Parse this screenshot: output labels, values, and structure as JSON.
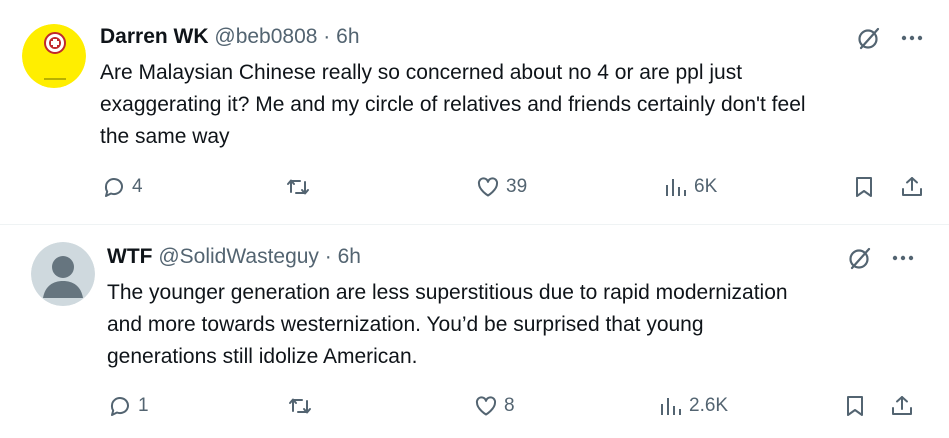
{
  "tweets": [
    {
      "author_name": "Darren WK",
      "handle": "@beb0808",
      "separator": "·",
      "time": "6h",
      "lines": [
        "Are Malaysian Chinese really so concerned about no 4 or are ppl just",
        "exaggerating it? Me and my circle of relatives and friends certainly don't feel",
        "the same way"
      ],
      "reply_count": "4",
      "retweet_count": "",
      "like_count": "39",
      "view_count": "6K",
      "avatar_color": "#ffee00"
    },
    {
      "author_name": "WTF",
      "handle": "@SolidWasteguy",
      "separator": "·",
      "time": "6h",
      "lines": [
        "The younger generation are less superstitious due to rapid modernization",
        "and more towards westernization. You’d be surprised that young",
        "generations still idolize American."
      ],
      "reply_count": "1",
      "retweet_count": "",
      "like_count": "8",
      "view_count": "2.6K",
      "avatar_color": "#cfd9de"
    }
  ],
  "colors": {
    "text_primary": "#0f1419",
    "text_secondary": "#536471",
    "divider": "#eff3f4"
  },
  "icons": {
    "reply": "reply-icon",
    "retweet": "retweet-icon",
    "like": "like-icon",
    "views": "views-icon",
    "bookmark": "bookmark-icon",
    "share": "share-icon",
    "grok": "grok-icon",
    "more": "more-icon"
  }
}
